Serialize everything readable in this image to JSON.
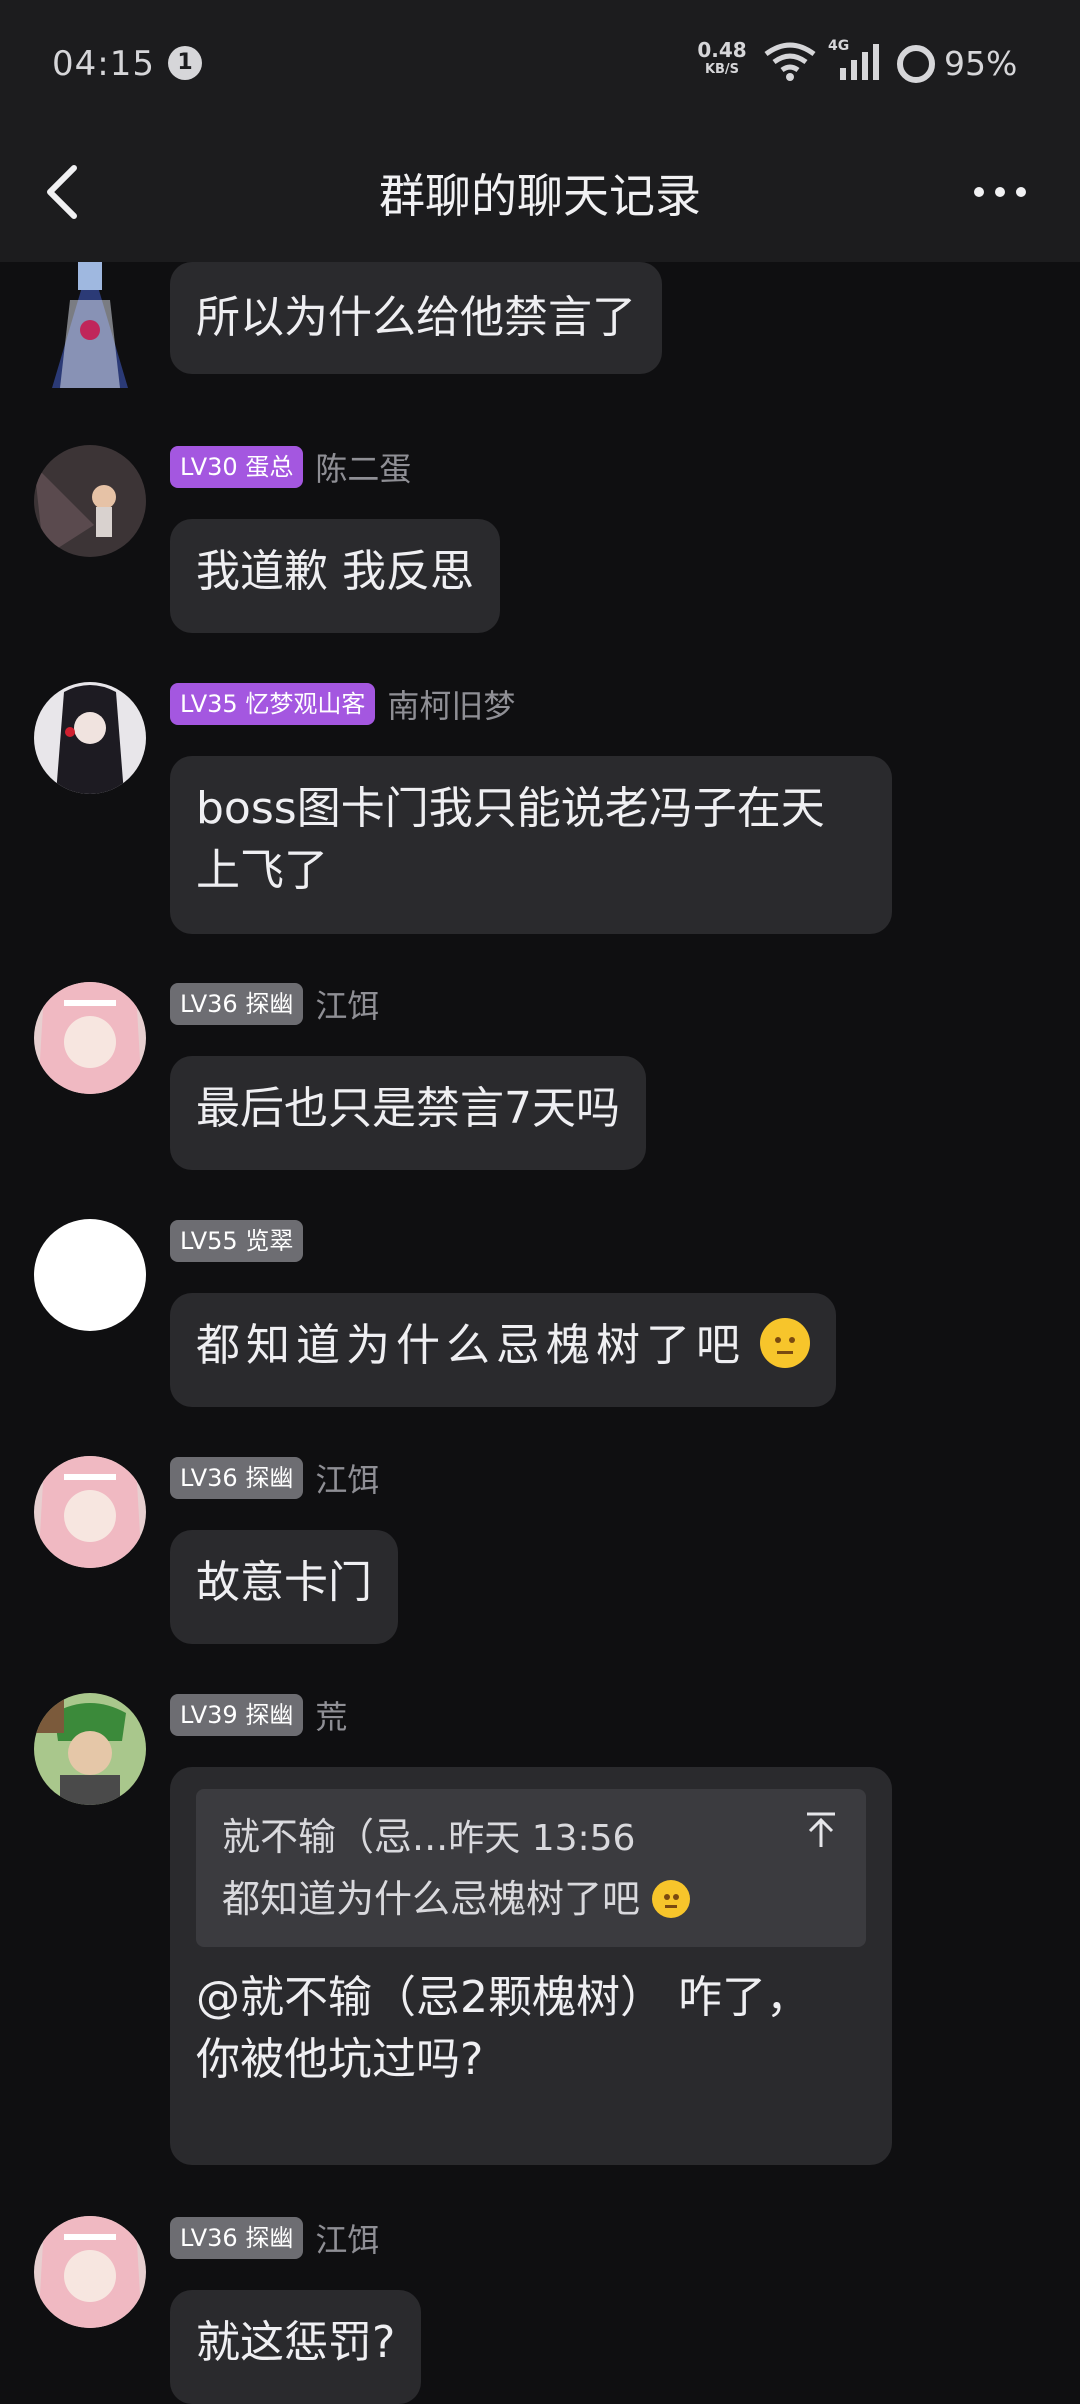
{
  "status_bar": {
    "time": "04:15",
    "notification_count": "1",
    "net_speed": "0.48",
    "net_speed_unit": "KB/S",
    "network": "4G",
    "battery": "95%"
  },
  "header": {
    "title": "群聊的聊天记录"
  },
  "messages": [
    {
      "text": "所以为什么给他禁言了"
    },
    {
      "level": "LV30 蛋总",
      "name": "陈二蛋",
      "text": "我道歉 我反思"
    },
    {
      "level": "LV35 忆梦观山客",
      "name": "南柯旧梦",
      "text_line1": "boss图卡门我只能说老冯子在天",
      "text_line2": "上飞了"
    },
    {
      "level": "LV36 探幽",
      "name": "江饵",
      "text": "最后也只是禁言7天吗"
    },
    {
      "level": "LV55 览翠",
      "name": "",
      "text": "都知道为什么忌槐树了吧"
    },
    {
      "level": "LV36 探幽",
      "name": "江饵",
      "text": "故意卡门"
    },
    {
      "level": "LV39 探幽",
      "name": "荒",
      "quote": {
        "sender": "就不输（忌...",
        "time": "昨天 13:56",
        "text": "都知道为什么忌槐树了吧"
      },
      "text_line1": "@就不输（忌2颗槐树） 咋了，",
      "text_line2": "你被他坑过吗?"
    },
    {
      "level": "LV36 探幽",
      "name": "江饵",
      "text": "就这惩罚?"
    }
  ],
  "colors": {
    "background": "#0f0f11",
    "header": "#1c1c1e",
    "bubble": "#2a2a2d",
    "level_purple": "#a457e0",
    "level_gray": "#6d6d72"
  }
}
